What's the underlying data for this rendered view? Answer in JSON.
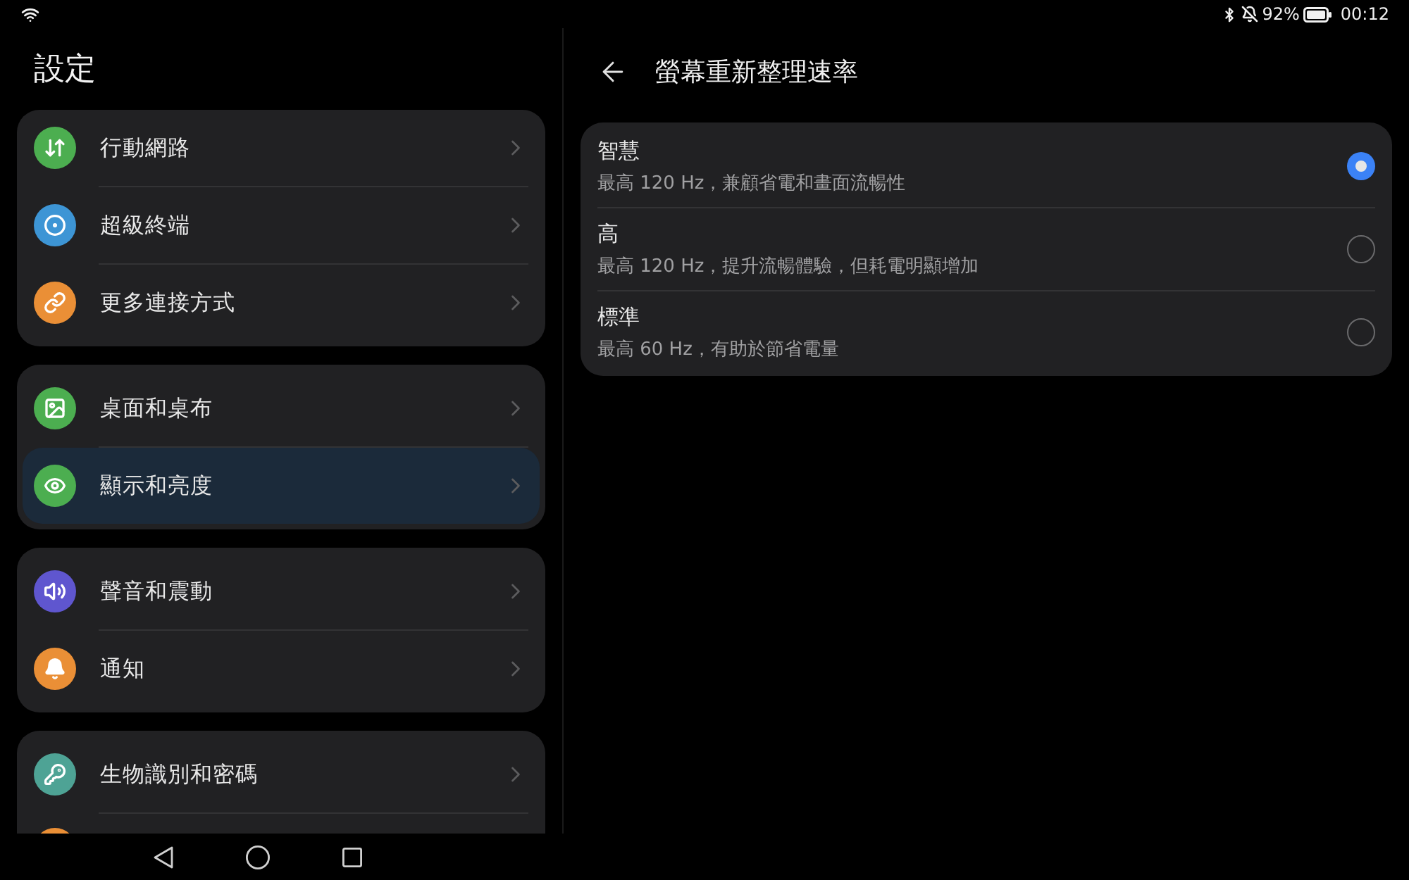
{
  "status_bar": {
    "battery_percent": "92%",
    "time": "00:12"
  },
  "settings": {
    "title": "設定",
    "groups": [
      {
        "items": [
          {
            "label": "行動網路",
            "color": "#4cae50",
            "selected": false
          },
          {
            "label": "超級終端",
            "color": "#3d95d5",
            "selected": false
          },
          {
            "label": "更多連接方式",
            "color": "#ea8f36",
            "selected": false
          }
        ]
      },
      {
        "items": [
          {
            "label": "桌面和桌布",
            "color": "#4cae50",
            "selected": false
          },
          {
            "label": "顯示和亮度",
            "color": "#4cae50",
            "selected": true
          }
        ]
      },
      {
        "items": [
          {
            "label": "聲音和震動",
            "color": "#5f56cf",
            "selected": false
          },
          {
            "label": "通知",
            "color": "#ea8f36",
            "selected": false
          }
        ]
      },
      {
        "items": [
          {
            "label": "生物識別和密碼",
            "color": "#4ea395",
            "selected": false,
            "cut_off": false
          },
          {
            "color": "#ea8f36",
            "selected": false,
            "cut_off": true
          }
        ]
      }
    ]
  },
  "detail": {
    "title": "螢幕重新整理速率",
    "options": [
      {
        "label": "智慧",
        "description": "最高 120 Hz，兼顧省電和畫面流暢性",
        "selected": true
      },
      {
        "label": "高",
        "description": "最高 120 Hz，提升流暢體驗，但耗電明顯增加",
        "selected": false
      },
      {
        "label": "標準",
        "description": "最高 60 Hz，有助於節省電量",
        "selected": false
      }
    ]
  }
}
